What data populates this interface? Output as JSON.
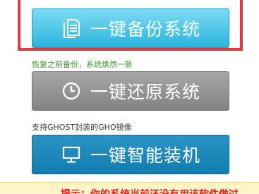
{
  "top_cut_text": "",
  "backup": {
    "label": "一键备份系统",
    "icon": "document-icon"
  },
  "restore": {
    "caption": "恢复之前备份，系统焕然一新",
    "label": "一键还原系统",
    "icon": "clock-icon"
  },
  "install": {
    "caption": "支持GHOST封装的GHO镜像",
    "label": "一键智能装机",
    "icon": "monitor-icon"
  },
  "tip": {
    "text": "提示：你的系统当前还没有用该软件做过"
  },
  "colors": {
    "highlight": "#e8383c",
    "backup_button": "#2ab4de",
    "restore_button": "#8a8a8a",
    "install_button": "#1682b8",
    "caption_green": "#3a9a2a",
    "tip_red": "#d8261f"
  }
}
